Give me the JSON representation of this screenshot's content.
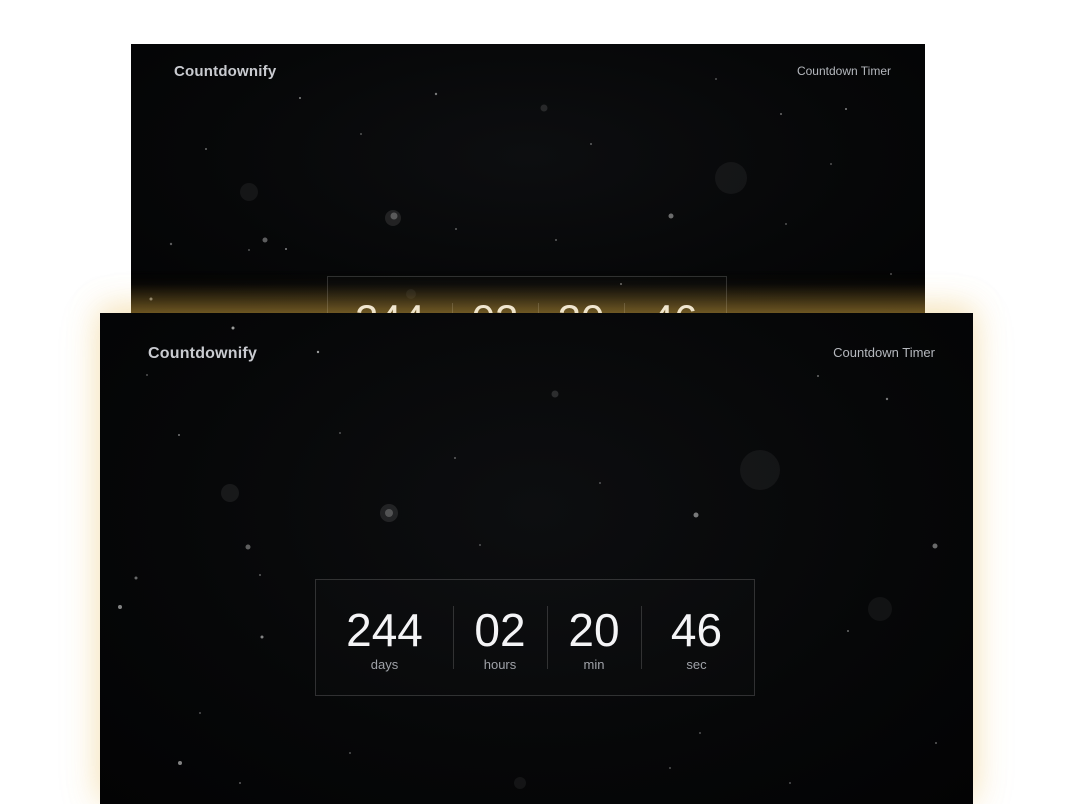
{
  "app": {
    "brand": "Countdownify",
    "nav_link": "Countdown Timer"
  },
  "countdown": {
    "days": {
      "value": "244",
      "label": "days"
    },
    "hours": {
      "value": "02",
      "label": "hours"
    },
    "min": {
      "value": "20",
      "label": "min"
    },
    "sec": {
      "value": "46",
      "label": "sec"
    }
  },
  "colors": {
    "background": "#050607",
    "text_primary": "#f4f4f6",
    "text_muted": "#9fa2a8",
    "glow": "#e8be5a"
  }
}
